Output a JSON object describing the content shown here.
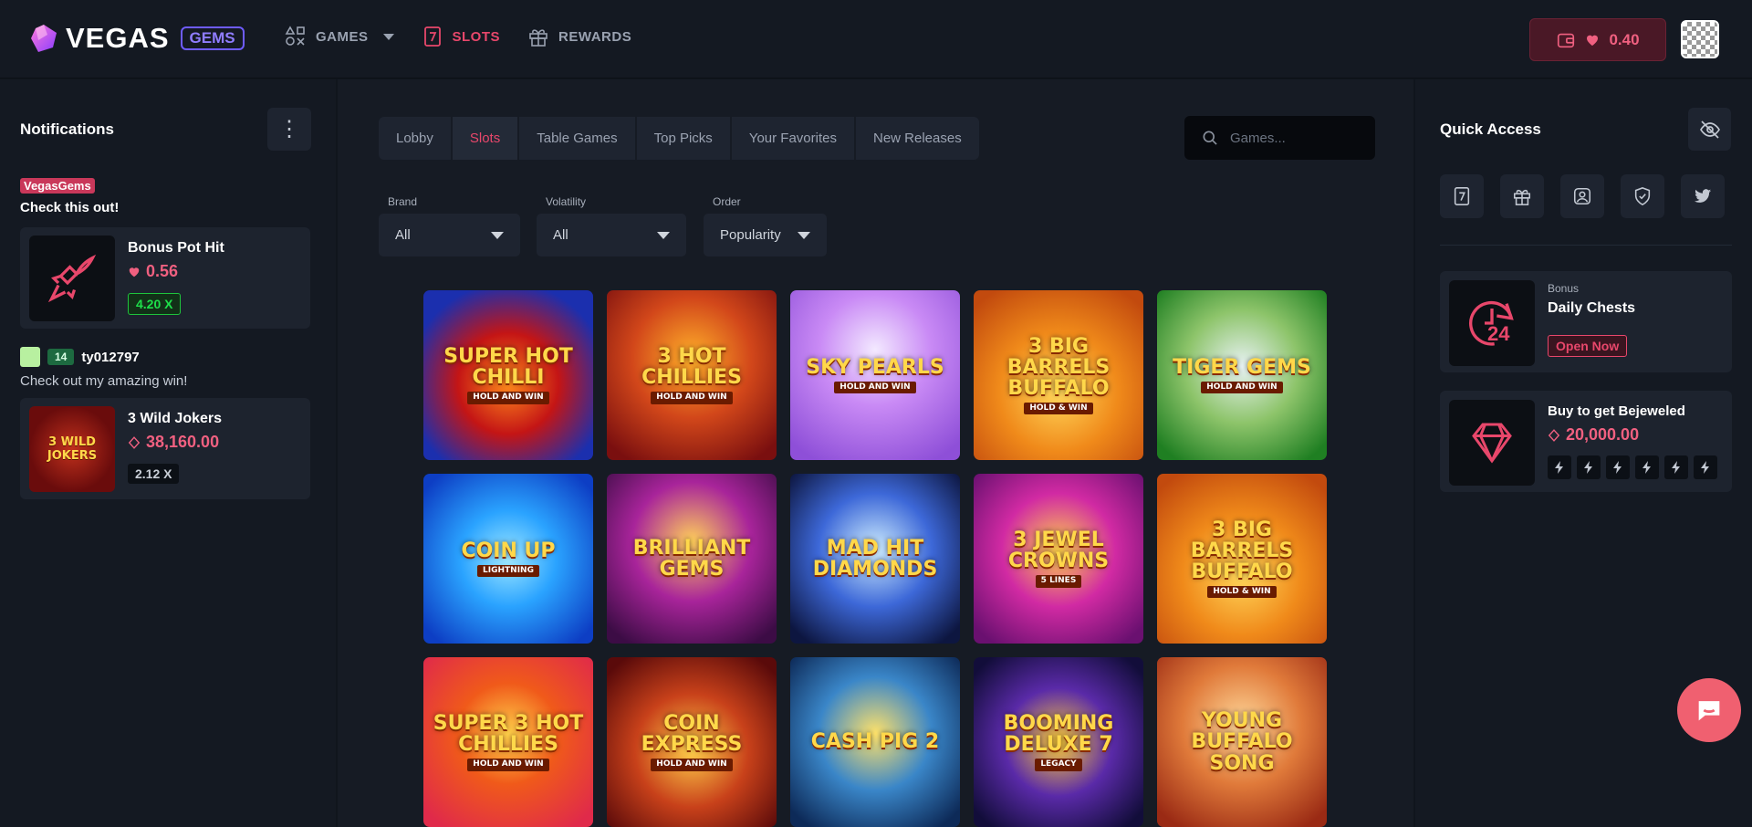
{
  "brand": {
    "logo_text": "VEGAS",
    "logo_badge": "GEMS"
  },
  "nav": {
    "games": "GAMES",
    "slots": "SLOTS",
    "rewards": "REWARDS"
  },
  "wallet": {
    "balance": "0.40"
  },
  "notifications": {
    "title": "Notifications",
    "tag": "VegasGems",
    "message": "Check this out!",
    "card1": {
      "name": "Bonus Pot Hit",
      "value": "0.56",
      "multiplier": "4.20 X"
    },
    "user": {
      "level": "14",
      "username": "ty012797",
      "message": "Check out my amazing win!"
    },
    "card2": {
      "name": "3 Wild Jokers",
      "value": "38,160.00",
      "multiplier": "2.12 X",
      "thumb_title": "3 WILD JOKERS"
    }
  },
  "tabs": [
    "Lobby",
    "Slots",
    "Table Games",
    "Top Picks",
    "Your Favorites",
    "New Releases"
  ],
  "search": {
    "placeholder": "Games..."
  },
  "filters": {
    "brand": {
      "label": "Brand",
      "value": "All"
    },
    "volatility": {
      "label": "Volatility",
      "value": "All"
    },
    "order": {
      "label": "Order",
      "value": "Popularity"
    }
  },
  "games": [
    {
      "title": "Super Hot Chilli",
      "sub": "HOLD AND WIN",
      "bg": "radial-gradient(circle at 50% 55%,#ff8a1c 0%,#c41515 40%,#1b2fae 80%)"
    },
    {
      "title": "3 Hot Chillies",
      "sub": "HOLD AND WIN",
      "bg": "radial-gradient(circle at 50% 40%,#ffb02a 0%,#d2471a 45%,#7a0f0f 90%)"
    },
    {
      "title": "Sky Pearls",
      "sub": "HOLD AND WIN",
      "bg": "radial-gradient(circle at 50% 35%,#f3e9ff 0%,#c98af5 40%,#8e4fd8 90%)"
    },
    {
      "title": "3 Big Barrels Buffalo",
      "sub": "HOLD & WIN",
      "bg": "radial-gradient(circle at 50% 60%,#ffd65a 0%,#f08a1a 45%,#c24a0e 90%)"
    },
    {
      "title": "Tiger Gems",
      "sub": "HOLD AND WIN",
      "bg": "radial-gradient(circle at 50% 45%,#e8f2f4 0%,#8dc46a 45%,#1f7f22 90%)"
    },
    {
      "title": "Coin Up",
      "sub": "LIGHTNING",
      "bg": "radial-gradient(circle at 50% 50%,#9fe8ff 0%,#2aa3ff 40%,#0d3ec4 90%)"
    },
    {
      "title": "Brilliant Gems",
      "sub": "",
      "bg": "radial-gradient(circle at 50% 40%,#ffcf5a 0%,#a8249a 45%,#3c0c45 90%)"
    },
    {
      "title": "Mad Hit Diamonds",
      "sub": "",
      "bg": "radial-gradient(circle at 50% 45%,#cfeeff 0%,#3d68d8 45%,#0d1640 90%)"
    },
    {
      "title": "3 Jewel Crowns",
      "sub": "5 LINES",
      "bg": "radial-gradient(circle at 50% 45%,#ffd24a 0%,#d12aa3 45%,#6a1070 90%)"
    },
    {
      "title": "3 Big Barrels Buffalo",
      "sub": "HOLD & WIN",
      "bg": "radial-gradient(circle at 50% 60%,#ffd65a 0%,#f08a1a 45%,#c24a0e 90%)"
    },
    {
      "title": "Super 3 Hot Chillies",
      "sub": "HOLD AND WIN",
      "bg": "radial-gradient(circle at 50% 45%,#ffd04a 0%,#f05a1a 40%,#e02a4a 90%)"
    },
    {
      "title": "Coin Express",
      "sub": "HOLD AND WIN",
      "bg": "radial-gradient(circle at 50% 55%,#ffce4a 0%,#c8411a 45%,#5a0a0a 90%)"
    },
    {
      "title": "Cash Pig 2",
      "sub": "",
      "bg": "radial-gradient(circle at 50% 45%,#ffe26a 0%,#3a86c8 45%,#0d2a58 90%)"
    },
    {
      "title": "Booming Deluxe 7",
      "sub": "LEGACY",
      "bg": "radial-gradient(circle at 50% 50%,#ffcf3a 0%,#5a2aa8 45%,#120d3a 90%)"
    },
    {
      "title": "Young Buffalo Song",
      "sub": "",
      "bg": "radial-gradient(circle at 50% 40%,#ffd89a 0%,#e07a3a 45%,#9a2a14 90%)"
    }
  ],
  "quick_access": {
    "title": "Quick Access",
    "chests": {
      "category": "Bonus",
      "title": "Daily Chests",
      "button": "Open Now",
      "icon_text": "24"
    },
    "bejeweled": {
      "title": "Buy to get Bejeweled",
      "value": "20,000.00"
    }
  },
  "colors": {
    "accent": "#e8476b",
    "bg": "#10151d",
    "panel": "#141922",
    "card": "#1d232e"
  }
}
